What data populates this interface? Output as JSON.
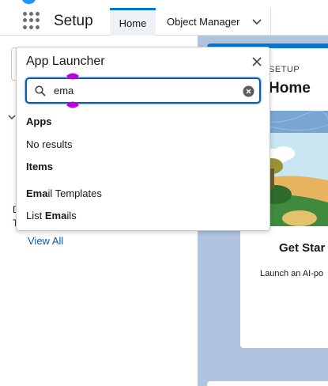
{
  "header": {
    "app_name": "Setup",
    "tabs": [
      {
        "label": "Home",
        "active": true
      },
      {
        "label": "Object Manager",
        "has_dropdown": true
      }
    ],
    "icons": [
      "app-launcher-waffle-icon",
      "chevron-down-icon"
    ]
  },
  "hero": {
    "breadcrumb": "SETUP",
    "title": "Home",
    "card_title": "Get Star",
    "card_text": "Launch an AI-po"
  },
  "left_fragments": {
    "line1": "D",
    "line2": "T"
  },
  "app_launcher": {
    "title": "App Launcher",
    "search": {
      "value": "ema"
    },
    "apps_heading": "Apps",
    "apps_no_results": "No results",
    "items_heading": "Items",
    "items": [
      {
        "match": "Ema",
        "rest": "il Templates",
        "prefix": ""
      },
      {
        "prefix": "List ",
        "match": "Ema",
        "rest": "ils"
      }
    ],
    "view_all_label": "View All"
  },
  "colors": {
    "brand_blue": "#0176d3",
    "focus_blue": "#0b5cab",
    "cursor_marker": "#c000e0",
    "hero_background": "#b0c4df"
  }
}
